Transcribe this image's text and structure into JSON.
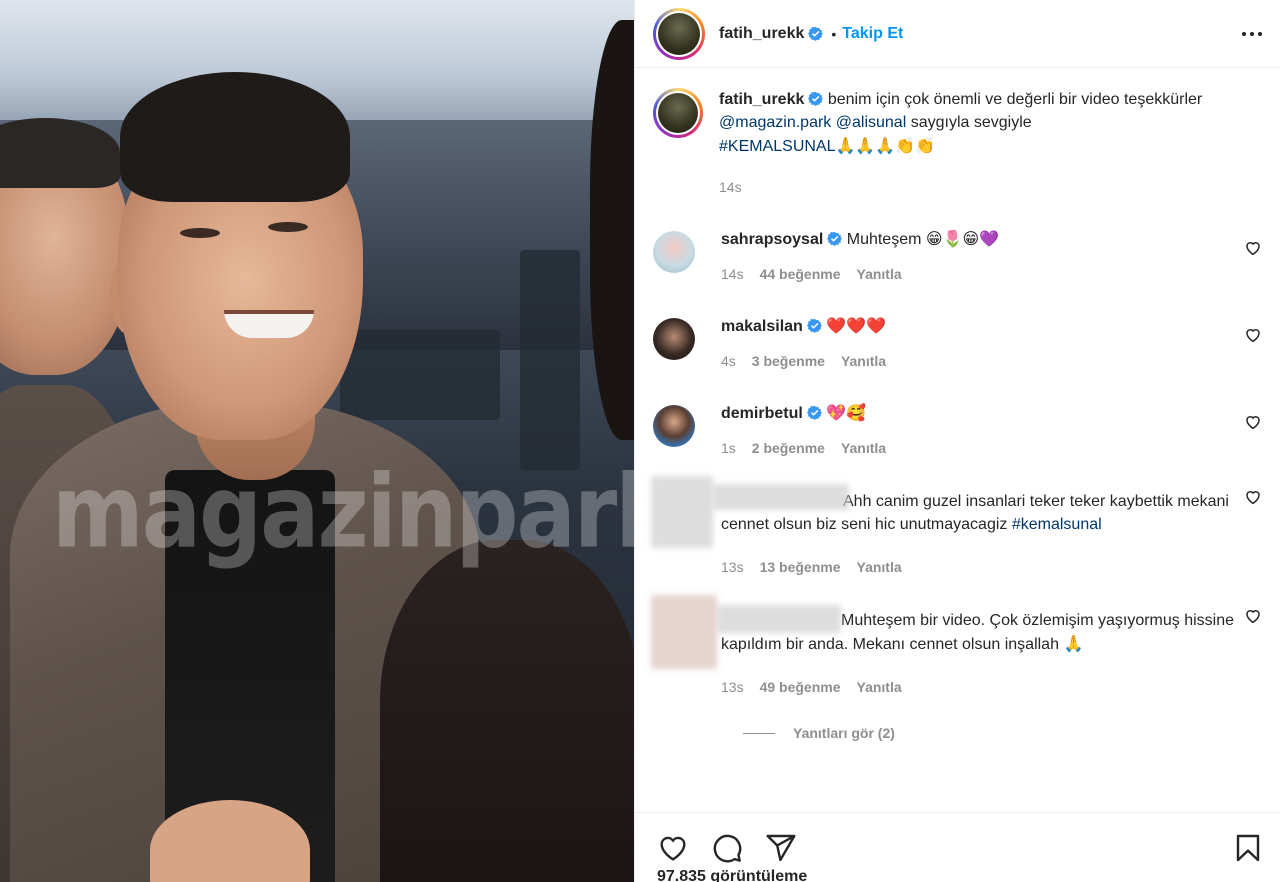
{
  "media": {
    "watermark": "magazinpark"
  },
  "header": {
    "username": "fatih_urekk",
    "separator": "•",
    "follow_label": "Takip Et"
  },
  "caption": {
    "username": "fatih_urekk",
    "text_part1": "benim için çok önemli ve değerli bir video teşekkürler",
    "mention1": "@magazin.park",
    "mention2": "@alisunal",
    "text_part2": "saygıyla sevgiyle",
    "hashtag": "#KEMALSUNAL",
    "emojis": "🙏🙏🙏👏👏",
    "time": "14s"
  },
  "comments": [
    {
      "username": "sahrapsoysal",
      "text": "Muhteşem",
      "emojis": "😁🌷😁💜",
      "time": "14s",
      "likes": "44 beğenme",
      "reply": "Yanıtla"
    },
    {
      "username": "makalsilan",
      "text": "",
      "emojis": "❤️❤️❤️",
      "time": "4s",
      "likes": "3 beğenme",
      "reply": "Yanıtla"
    },
    {
      "username": "demirbetul",
      "text": "",
      "emojis": "💖🥰",
      "time": "1s",
      "likes": "2 beğenme",
      "reply": "Yanıtla"
    },
    {
      "text": "Ahh canim guzel insanlari teker teker kaybettik mekani cennet olsun biz seni hic unutmayacagiz",
      "hashtag": "#kemalsunal",
      "time": "13s",
      "likes": "13 beğenme",
      "reply": "Yanıtla"
    },
    {
      "text": "Muhteşem bir video. Çok özlemişim yaşıyormuş hissine kapıldım bir anda. Mekanı cennet olsun inşallah",
      "emojis": "🙏",
      "time": "13s",
      "likes": "49 beğenme",
      "reply": "Yanıtla"
    }
  ],
  "view_replies": "Yanıtları gör (2)",
  "views": "97.835 görüntüleme",
  "colors": {
    "accent": "#0095f6",
    "verified": "#3897f0",
    "link": "#00376b",
    "muted": "#8e8e8e"
  },
  "icons": {
    "like": "heart-icon",
    "comment": "comment-icon",
    "share": "share-icon",
    "save": "bookmark-icon",
    "more": "more-icon",
    "verified": "verified-badge-icon"
  }
}
